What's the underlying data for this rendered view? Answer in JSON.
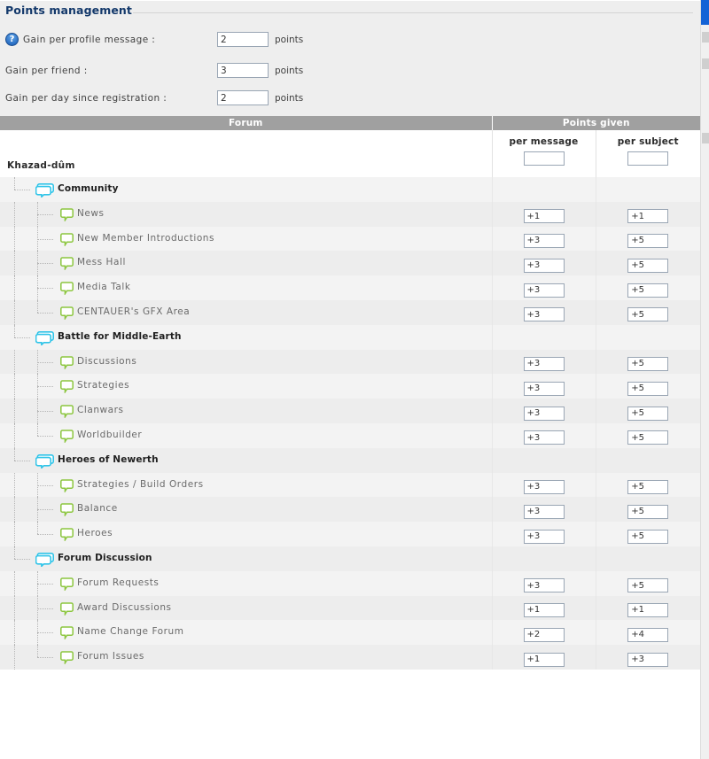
{
  "panel": {
    "title": "Points management",
    "help_icon": "question-help-icon",
    "rows": [
      {
        "label": "Gain per profile message :",
        "value": "2",
        "unit": "points",
        "has_help": true
      },
      {
        "label": "Gain per friend :",
        "value": "3",
        "unit": "points",
        "has_help": false
      },
      {
        "label": "Gain per day since registration :",
        "value": "2",
        "unit": "points",
        "has_help": false
      }
    ]
  },
  "table": {
    "headers": {
      "forum": "Forum",
      "points_given": "Points given"
    },
    "subheaders": {
      "per_message": "per message",
      "per_subject": "per subject"
    },
    "root": {
      "name": "Khazad-dûm",
      "per_message": "",
      "per_subject": ""
    },
    "rows": [
      {
        "type": "category",
        "name": "Community",
        "icon": "double-speech-bubble-icon",
        "per_message": "",
        "per_subject": ""
      },
      {
        "type": "forum",
        "name": "News",
        "icon": "speech-bubble-icon",
        "per_message": "+1",
        "per_subject": "+1"
      },
      {
        "type": "forum",
        "name": "New Member Introductions",
        "icon": "speech-bubble-icon",
        "per_message": "+3",
        "per_subject": "+5"
      },
      {
        "type": "forum",
        "name": "Mess Hall",
        "icon": "speech-bubble-icon",
        "per_message": "+3",
        "per_subject": "+5"
      },
      {
        "type": "forum",
        "name": "Media Talk",
        "icon": "speech-bubble-icon",
        "per_message": "+3",
        "per_subject": "+5"
      },
      {
        "type": "forum",
        "name": "CENTAUER's GFX Area",
        "icon": "speech-bubble-icon",
        "per_message": "+3",
        "per_subject": "+5",
        "last": true
      },
      {
        "type": "category",
        "name": "Battle for Middle-Earth",
        "icon": "double-speech-bubble-icon",
        "per_message": "",
        "per_subject": ""
      },
      {
        "type": "forum",
        "name": "Discussions",
        "icon": "speech-bubble-icon",
        "per_message": "+3",
        "per_subject": "+5"
      },
      {
        "type": "forum",
        "name": "Strategies",
        "icon": "speech-bubble-icon",
        "per_message": "+3",
        "per_subject": "+5"
      },
      {
        "type": "forum",
        "name": "Clanwars",
        "icon": "speech-bubble-icon",
        "per_message": "+3",
        "per_subject": "+5"
      },
      {
        "type": "forum",
        "name": "Worldbuilder",
        "icon": "speech-bubble-icon",
        "per_message": "+3",
        "per_subject": "+5",
        "last": true
      },
      {
        "type": "category",
        "name": "Heroes of Newerth",
        "icon": "double-speech-bubble-icon",
        "per_message": "",
        "per_subject": ""
      },
      {
        "type": "forum",
        "name": "Strategies / Build Orders",
        "icon": "speech-bubble-icon",
        "per_message": "+3",
        "per_subject": "+5"
      },
      {
        "type": "forum",
        "name": "Balance",
        "icon": "speech-bubble-icon",
        "per_message": "+3",
        "per_subject": "+5"
      },
      {
        "type": "forum",
        "name": "Heroes",
        "icon": "speech-bubble-icon",
        "per_message": "+3",
        "per_subject": "+5",
        "last": true
      },
      {
        "type": "category",
        "name": "Forum Discussion",
        "icon": "double-speech-bubble-icon",
        "per_message": "",
        "per_subject": ""
      },
      {
        "type": "forum",
        "name": "Forum Requests",
        "icon": "speech-bubble-icon",
        "per_message": "+3",
        "per_subject": "+5"
      },
      {
        "type": "forum",
        "name": "Award Discussions",
        "icon": "speech-bubble-icon",
        "per_message": "+1",
        "per_subject": "+1"
      },
      {
        "type": "forum",
        "name": "Name Change Forum",
        "icon": "speech-bubble-icon",
        "per_message": "+2",
        "per_subject": "+4"
      },
      {
        "type": "forum",
        "name": "Forum Issues",
        "icon": "speech-bubble-icon",
        "per_message": "+1",
        "per_subject": "+3",
        "last": true
      }
    ]
  },
  "colors": {
    "title": "#14396b",
    "header_bar": "#a0a0a0",
    "category_icon": "#30c4e8",
    "forum_icon": "#8cc63f",
    "scrollbar_thumb": "#1463d6",
    "panel_bg": "#eeeeee"
  },
  "scrollbar": {
    "name": "vertical-scrollbar"
  }
}
